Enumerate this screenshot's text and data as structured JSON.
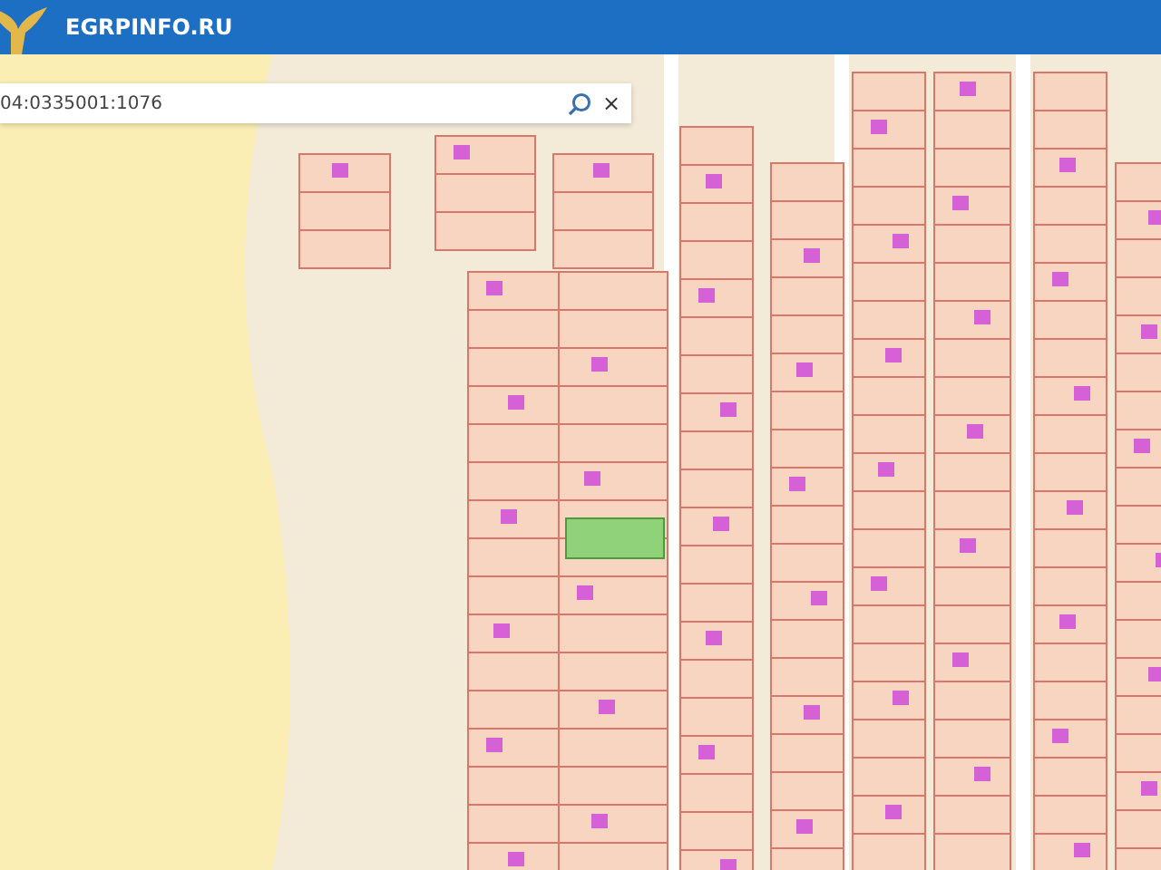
{
  "header": {
    "title": "EGRPINFO.RU"
  },
  "search": {
    "value": "04:0335001:1076",
    "clear": "×"
  }
}
